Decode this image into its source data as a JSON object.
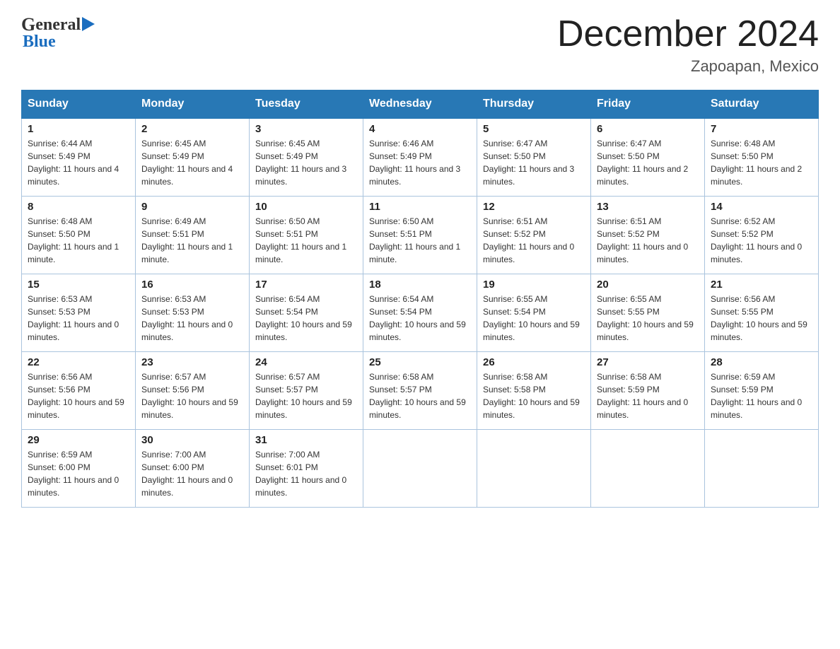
{
  "header": {
    "month_title": "December 2024",
    "location": "Zapoapan, Mexico",
    "logo_text1": "General",
    "logo_text2": "Blue"
  },
  "days_of_week": [
    "Sunday",
    "Monday",
    "Tuesday",
    "Wednesday",
    "Thursday",
    "Friday",
    "Saturday"
  ],
  "weeks": [
    [
      {
        "day": "1",
        "sunrise": "6:44 AM",
        "sunset": "5:49 PM",
        "daylight": "11 hours and 4 minutes."
      },
      {
        "day": "2",
        "sunrise": "6:45 AM",
        "sunset": "5:49 PM",
        "daylight": "11 hours and 4 minutes."
      },
      {
        "day": "3",
        "sunrise": "6:45 AM",
        "sunset": "5:49 PM",
        "daylight": "11 hours and 3 minutes."
      },
      {
        "day": "4",
        "sunrise": "6:46 AM",
        "sunset": "5:49 PM",
        "daylight": "11 hours and 3 minutes."
      },
      {
        "day": "5",
        "sunrise": "6:47 AM",
        "sunset": "5:50 PM",
        "daylight": "11 hours and 3 minutes."
      },
      {
        "day": "6",
        "sunrise": "6:47 AM",
        "sunset": "5:50 PM",
        "daylight": "11 hours and 2 minutes."
      },
      {
        "day": "7",
        "sunrise": "6:48 AM",
        "sunset": "5:50 PM",
        "daylight": "11 hours and 2 minutes."
      }
    ],
    [
      {
        "day": "8",
        "sunrise": "6:48 AM",
        "sunset": "5:50 PM",
        "daylight": "11 hours and 1 minute."
      },
      {
        "day": "9",
        "sunrise": "6:49 AM",
        "sunset": "5:51 PM",
        "daylight": "11 hours and 1 minute."
      },
      {
        "day": "10",
        "sunrise": "6:50 AM",
        "sunset": "5:51 PM",
        "daylight": "11 hours and 1 minute."
      },
      {
        "day": "11",
        "sunrise": "6:50 AM",
        "sunset": "5:51 PM",
        "daylight": "11 hours and 1 minute."
      },
      {
        "day": "12",
        "sunrise": "6:51 AM",
        "sunset": "5:52 PM",
        "daylight": "11 hours and 0 minutes."
      },
      {
        "day": "13",
        "sunrise": "6:51 AM",
        "sunset": "5:52 PM",
        "daylight": "11 hours and 0 minutes."
      },
      {
        "day": "14",
        "sunrise": "6:52 AM",
        "sunset": "5:52 PM",
        "daylight": "11 hours and 0 minutes."
      }
    ],
    [
      {
        "day": "15",
        "sunrise": "6:53 AM",
        "sunset": "5:53 PM",
        "daylight": "11 hours and 0 minutes."
      },
      {
        "day": "16",
        "sunrise": "6:53 AM",
        "sunset": "5:53 PM",
        "daylight": "11 hours and 0 minutes."
      },
      {
        "day": "17",
        "sunrise": "6:54 AM",
        "sunset": "5:54 PM",
        "daylight": "10 hours and 59 minutes."
      },
      {
        "day": "18",
        "sunrise": "6:54 AM",
        "sunset": "5:54 PM",
        "daylight": "10 hours and 59 minutes."
      },
      {
        "day": "19",
        "sunrise": "6:55 AM",
        "sunset": "5:54 PM",
        "daylight": "10 hours and 59 minutes."
      },
      {
        "day": "20",
        "sunrise": "6:55 AM",
        "sunset": "5:55 PM",
        "daylight": "10 hours and 59 minutes."
      },
      {
        "day": "21",
        "sunrise": "6:56 AM",
        "sunset": "5:55 PM",
        "daylight": "10 hours and 59 minutes."
      }
    ],
    [
      {
        "day": "22",
        "sunrise": "6:56 AM",
        "sunset": "5:56 PM",
        "daylight": "10 hours and 59 minutes."
      },
      {
        "day": "23",
        "sunrise": "6:57 AM",
        "sunset": "5:56 PM",
        "daylight": "10 hours and 59 minutes."
      },
      {
        "day": "24",
        "sunrise": "6:57 AM",
        "sunset": "5:57 PM",
        "daylight": "10 hours and 59 minutes."
      },
      {
        "day": "25",
        "sunrise": "6:58 AM",
        "sunset": "5:57 PM",
        "daylight": "10 hours and 59 minutes."
      },
      {
        "day": "26",
        "sunrise": "6:58 AM",
        "sunset": "5:58 PM",
        "daylight": "10 hours and 59 minutes."
      },
      {
        "day": "27",
        "sunrise": "6:58 AM",
        "sunset": "5:59 PM",
        "daylight": "11 hours and 0 minutes."
      },
      {
        "day": "28",
        "sunrise": "6:59 AM",
        "sunset": "5:59 PM",
        "daylight": "11 hours and 0 minutes."
      }
    ],
    [
      {
        "day": "29",
        "sunrise": "6:59 AM",
        "sunset": "6:00 PM",
        "daylight": "11 hours and 0 minutes."
      },
      {
        "day": "30",
        "sunrise": "7:00 AM",
        "sunset": "6:00 PM",
        "daylight": "11 hours and 0 minutes."
      },
      {
        "day": "31",
        "sunrise": "7:00 AM",
        "sunset": "6:01 PM",
        "daylight": "11 hours and 0 minutes."
      },
      null,
      null,
      null,
      null
    ]
  ]
}
